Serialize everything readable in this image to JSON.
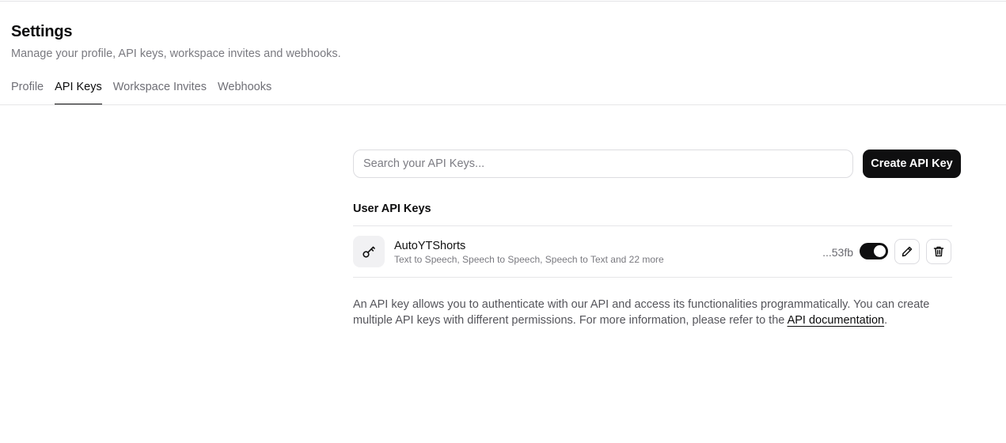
{
  "header": {
    "title": "Settings",
    "subtitle": "Manage your profile, API keys, workspace invites and webhooks."
  },
  "tabs": [
    {
      "label": "Profile",
      "active": false
    },
    {
      "label": "API Keys",
      "active": true
    },
    {
      "label": "Workspace Invites",
      "active": false
    },
    {
      "label": "Webhooks",
      "active": false
    }
  ],
  "search": {
    "placeholder": "Search your API Keys...",
    "value": ""
  },
  "actions": {
    "create_label": "Create API Key"
  },
  "user_keys": {
    "section_title": "User API Keys",
    "items": [
      {
        "name": "AutoYTShorts",
        "scopes": "Text to Speech, Speech to Speech, Speech to Text and 22 more",
        "suffix": "...53fb",
        "enabled": true,
        "icon": "key-icon"
      }
    ]
  },
  "info": {
    "text": "An API key allows you to authenticate with our API and access its functionalities programmatically. You can create multiple API keys with different permissions. For more information, please refer to the ",
    "link_label": "API documentation",
    "end": "."
  },
  "colors": {
    "primary": "#0f0f10",
    "muted_text": "#7a7a80",
    "border": "#e6e6e8"
  }
}
